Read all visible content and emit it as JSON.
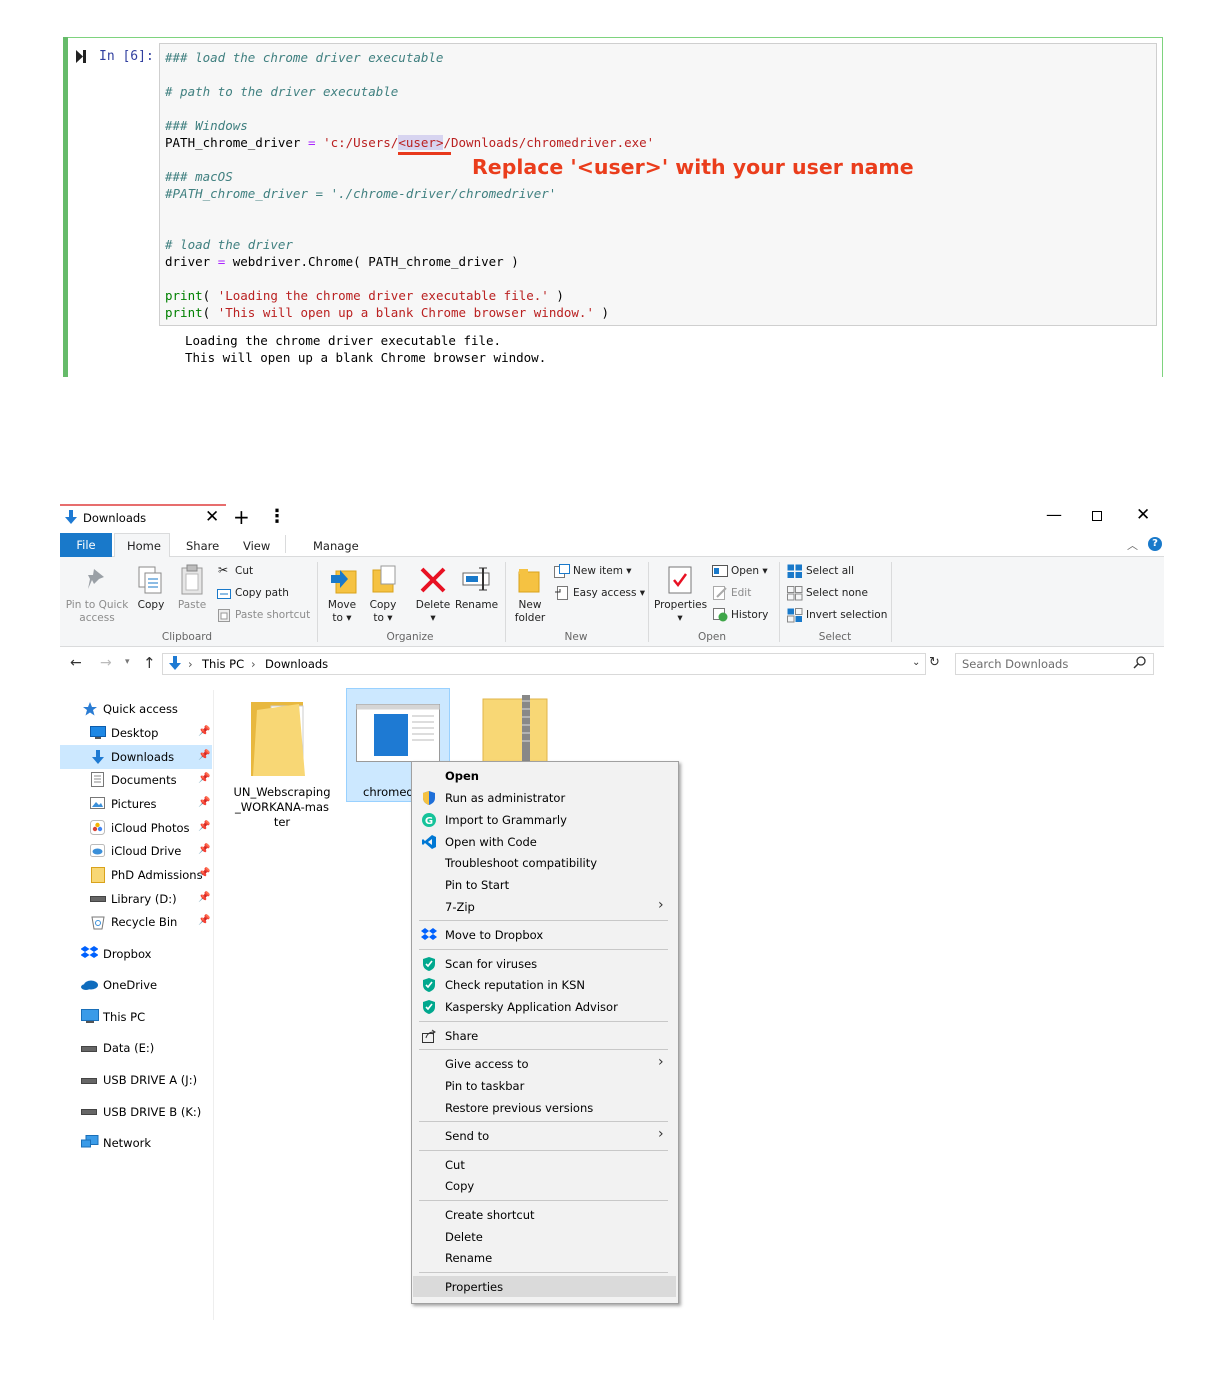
{
  "notebook": {
    "prompt": "In [6]:",
    "code_lines": {
      "l1": "### load the chrome driver executable",
      "l2": "# path to the driver executable",
      "l3": "### Windows",
      "l4a": "PATH_chrome_driver",
      "l4b": "=",
      "l4c": "'c:/Users/",
      "l4d": "<user>",
      "l4e": "/Downloads/chromedriver.exe'",
      "l5": "### macOS",
      "l6": "#PATH_chrome_driver = './chrome-driver/chromedriver'",
      "l7": "# load the driver",
      "l8a": "driver",
      "l8b": "=",
      "l8c": "webdriver.Chrome( PATH_chrome_driver )",
      "l9a": "print",
      "l9b": "( ",
      "l9c": "'Loading the chrome driver executable file.'",
      "l9d": " )",
      "l10a": "print",
      "l10b": "( ",
      "l10c": "'This will open up a blank Chrome browser window.'",
      "l10d": " )"
    },
    "annotation": "Replace '<user>' with your user name",
    "output_lines": [
      "Loading the chrome driver executable file.",
      "This will open up a blank Chrome browser window."
    ]
  },
  "window": {
    "tab_title": "Downloads",
    "close_glyph": "✕",
    "new_tab_glyph": "+",
    "menu_glyph": "⋮",
    "minimize_glyph": "—",
    "help_glyph": "?"
  },
  "ribbon": {
    "tabs": {
      "file": "File",
      "home": "Home",
      "share": "Share",
      "view": "View",
      "manage": "Manage"
    },
    "clipboard": {
      "pin": "Pin to Quick",
      "pin2": "access",
      "copy": "Copy",
      "paste": "Paste",
      "cut": "Cut",
      "copy_path": "Copy path",
      "paste_shortcut": "Paste shortcut",
      "group": "Clipboard"
    },
    "organize": {
      "move": "Move",
      "move2": "to ▾",
      "copy": "Copy",
      "copy2": "to ▾",
      "delete": "Delete",
      "delete2": "▾",
      "rename": "Rename",
      "group": "Organize"
    },
    "new": {
      "new_folder": "New",
      "new_folder2": "folder",
      "new_item": "New item ▾",
      "easy_access": "Easy access ▾",
      "group": "New"
    },
    "open": {
      "properties": "Properties",
      "properties2": "▾",
      "open": "Open ▾",
      "edit": "Edit",
      "history": "History",
      "group": "Open"
    },
    "select": {
      "select_all": "Select all",
      "select_none": "Select none",
      "invert": "Invert selection",
      "group": "Select"
    }
  },
  "address": {
    "crumbs": [
      "This PC",
      "Downloads"
    ],
    "sep": "›",
    "search_placeholder": "Search Downloads"
  },
  "sidebar": {
    "items": [
      "Quick access",
      "Desktop",
      "Downloads",
      "Documents",
      "Pictures",
      "iCloud Photos",
      "iCloud Drive",
      "PhD Admissions",
      "Library (D:)",
      "Recycle Bin",
      "Dropbox",
      "OneDrive",
      "This PC",
      "Data (E:)",
      "USB DRIVE A (J:)",
      "USB DRIVE B (K:)",
      "Network"
    ]
  },
  "files": {
    "f1": "UN_Webscraping\n_WORKANA-mas\nter",
    "f2": "chromed"
  },
  "context_menu": {
    "items": [
      "Open",
      "Run as administrator",
      "Import to Grammarly",
      "Open with Code",
      "Troubleshoot compatibility",
      "Pin to Start",
      "7-Zip",
      "Move to Dropbox",
      "Scan for viruses",
      "Check reputation in KSN",
      "Kaspersky Application Advisor",
      "Share",
      "Give access to",
      "Pin to taskbar",
      "Restore previous versions",
      "Send to",
      "Cut",
      "Copy",
      "Create shortcut",
      "Delete",
      "Rename",
      "Properties"
    ]
  },
  "colors": {
    "accent": "#1979ca",
    "annotation": "#ea3d1c",
    "cell_border": "#66bb6a",
    "selection": "#cce8ff"
  }
}
